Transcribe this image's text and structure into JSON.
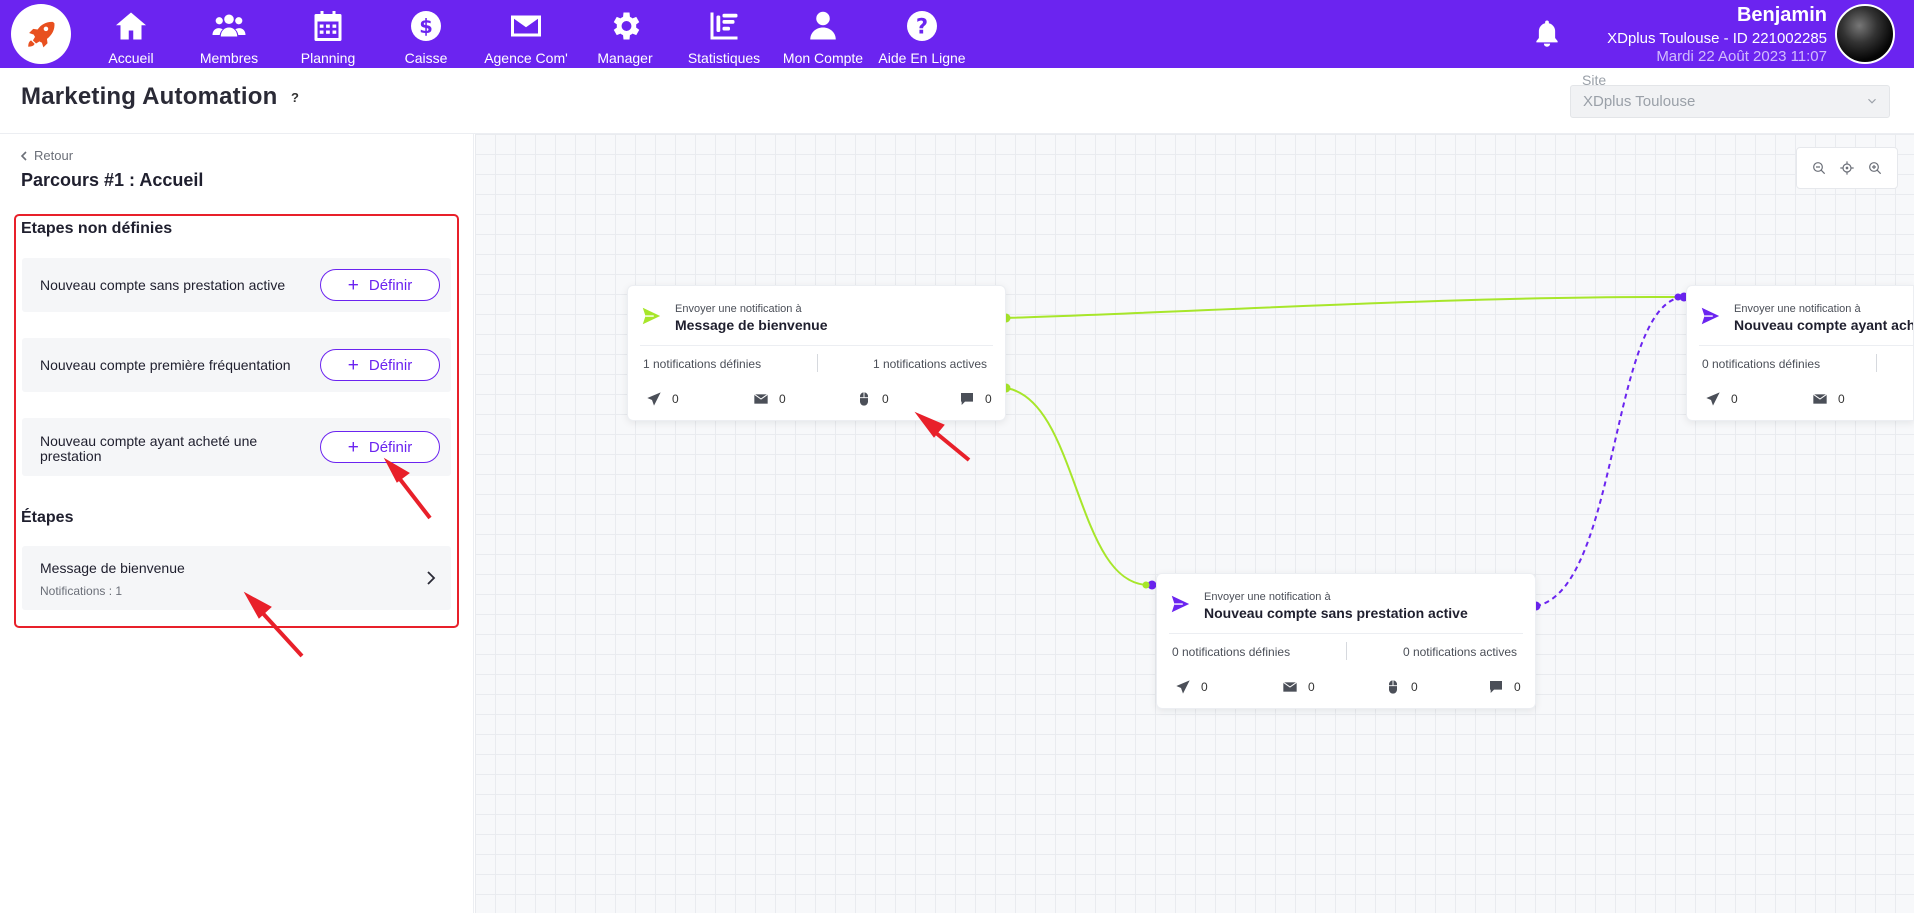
{
  "nav": {
    "items": [
      {
        "label": "Accueil",
        "icon": "home-icon"
      },
      {
        "label": "Membres",
        "icon": "users-icon"
      },
      {
        "label": "Planning",
        "icon": "calendar-icon"
      },
      {
        "label": "Caisse",
        "icon": "dollar-icon"
      },
      {
        "label": "Agence Com'",
        "icon": "envelope-icon"
      },
      {
        "label": "Manager",
        "icon": "gear-icon"
      },
      {
        "label": "Statistiques",
        "icon": "chart-icon"
      },
      {
        "label": "Mon Compte",
        "icon": "user-icon"
      },
      {
        "label": "Aide En Ligne",
        "icon": "question-icon"
      }
    ],
    "user": {
      "name": "Benjamin",
      "site": "XDplus Toulouse - ID 221002285",
      "date": "Mardi 22 Août 2023 11:07"
    }
  },
  "header": {
    "title": "Marketing Automation",
    "help": "?",
    "site_label": "Site",
    "site_value": "XDplus Toulouse"
  },
  "left": {
    "back_label": "Retour",
    "parcours_title": "Parcours #1 : Accueil",
    "undefined_heading": "Etapes non définies",
    "undefined_steps": [
      {
        "label": "Nouveau compte sans prestation active"
      },
      {
        "label": "Nouveau compte première fréquentation"
      },
      {
        "label": "Nouveau compte ayant acheté une prestation"
      }
    ],
    "define_label": "Définir",
    "steps_heading": "Étapes",
    "steps": [
      {
        "label": "Message de bienvenue",
        "sub": "Notifications : 1"
      }
    ]
  },
  "canvas": {
    "nodes": [
      {
        "pre": "Envoyer une notification à",
        "title": "Message de bienvenue",
        "defined": "1 notifications définies",
        "active": "1 notifications actives",
        "stats": [
          "0",
          "0",
          "0",
          "0"
        ],
        "icon_color": "#a7e62a"
      },
      {
        "pre": "Envoyer une notification à",
        "title": "Nouveau compte sans prestation active",
        "defined": "0 notifications définies",
        "active": "0 notifications actives",
        "stats": [
          "0",
          "0",
          "0",
          "0"
        ],
        "icon_color": "#6b24f0"
      },
      {
        "pre": "Envoyer une notification à",
        "title": "Nouveau compte ayant acheté une prestation",
        "defined": "0 notifications définies",
        "active": "",
        "stats": [
          "0",
          "0"
        ],
        "icon_color": "#6b24f0"
      }
    ]
  },
  "colors": {
    "brand": "#6b24f0",
    "link_green": "#a7e62a",
    "annotation_red": "#e8202a"
  }
}
